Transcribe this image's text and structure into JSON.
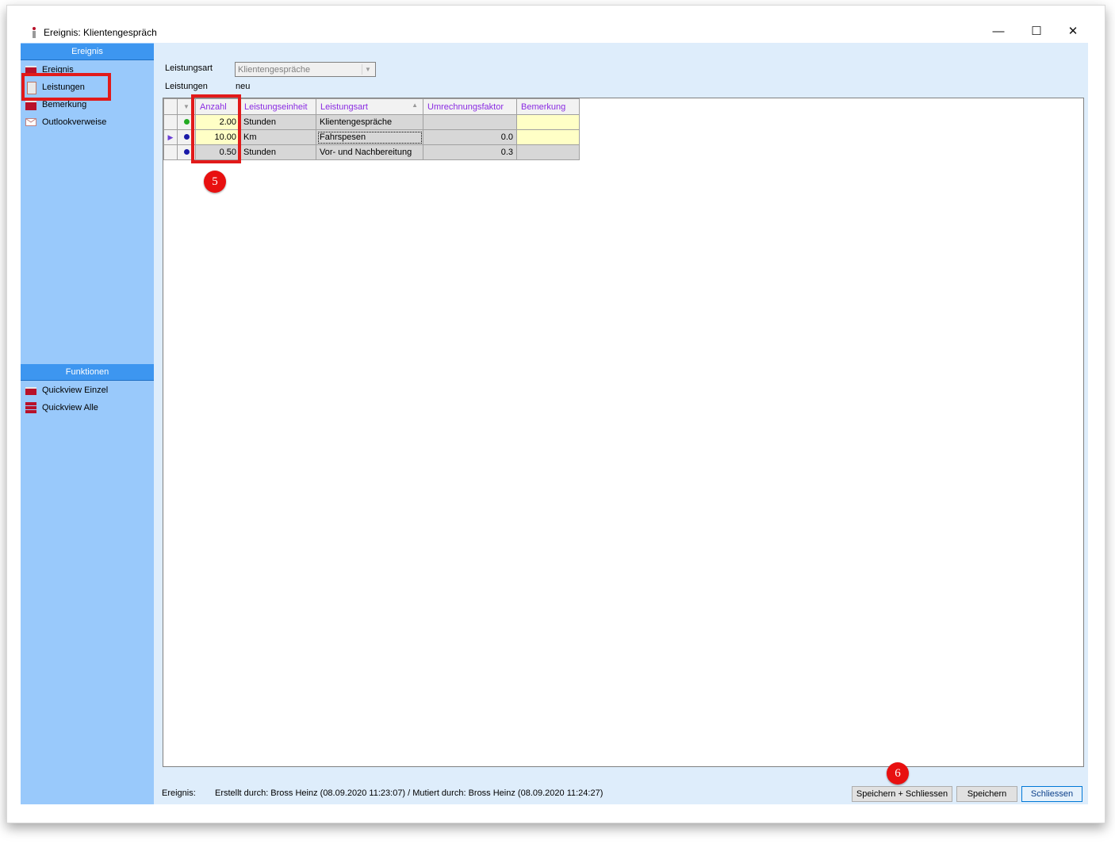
{
  "window": {
    "title": "Ereignis: Klientengespräch",
    "controls": {
      "minimize": "—",
      "maximize": "☐",
      "close": "✕"
    }
  },
  "sidebar": {
    "ereignis_header": "Ereignis",
    "items": [
      {
        "label": "Ereignis",
        "icon": "red-tray-icon"
      },
      {
        "label": "Leistungen",
        "icon": "user-icon"
      },
      {
        "label": "Bemerkung",
        "icon": "red-tray-icon"
      },
      {
        "label": "Outlookverweise",
        "icon": "envelope-icon"
      }
    ],
    "funktionen_header": "Funktionen",
    "funktionen": [
      {
        "label": "Quickview Einzel",
        "icon": "quickview-single-icon"
      },
      {
        "label": "Quickview Alle",
        "icon": "quickview-all-icon"
      }
    ]
  },
  "form": {
    "leistungsart_label": "Leistungsart",
    "leistungsart_value": "Klientengespräche",
    "leistungen_label": "Leistungen",
    "leistungen_value": "neu"
  },
  "grid": {
    "columns": [
      "Anzahl",
      "Leistungseinheit",
      "Leistungsart",
      "Umrechnungsfaktor",
      "Bemerkung"
    ],
    "rows": [
      {
        "status_color": "#22aa22",
        "anzahl": "2.00",
        "einheit": "Stunden",
        "art": "Klientengespräche",
        "faktor": "",
        "bemerkung": ""
      },
      {
        "status_color": "#1a1aa8",
        "anzahl": "10.00",
        "einheit": "Km",
        "art": "Fahrspesen",
        "faktor": "0.0",
        "bemerkung": ""
      },
      {
        "status_color": "#1a1aa8",
        "anzahl": "0.50",
        "einheit": "Stunden",
        "art": "Vor- und Nachbereitung",
        "faktor": "0.3",
        "bemerkung": ""
      }
    ]
  },
  "badges": {
    "five": "5",
    "six": "6"
  },
  "status": {
    "label": "Ereignis:",
    "text": "Erstellt durch: Bross Heinz (08.09.2020 11:23:07) / Mutiert durch: Bross Heinz (08.09.2020 11:24:27)"
  },
  "buttons": {
    "save_close": "Speichern + Schliessen",
    "save": "Speichern",
    "close": "Schliessen"
  },
  "colors": {
    "highlight": "#e21a1a",
    "sidebar": "#99c9fb",
    "header": "#3d96f0"
  }
}
